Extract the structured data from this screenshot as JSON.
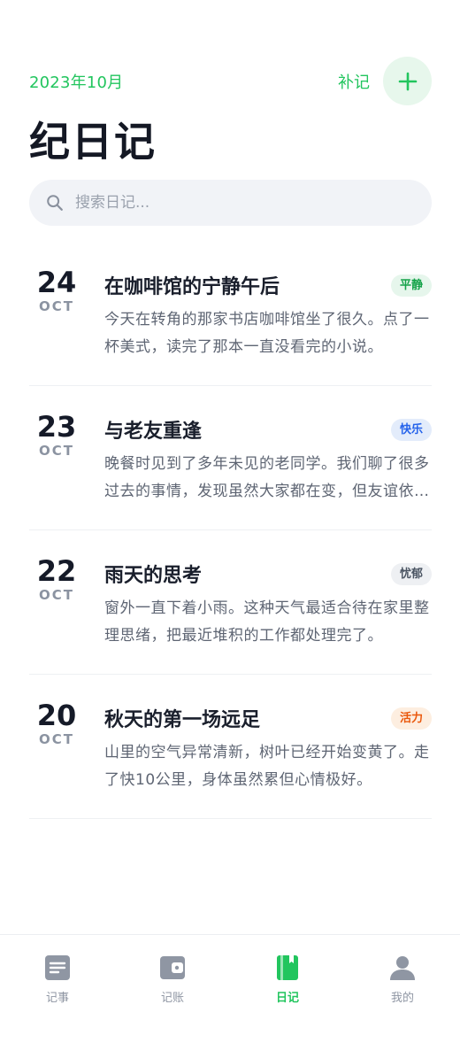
{
  "header": {
    "month": "2023年10月",
    "backfill_label": "补记",
    "title": "纪日记"
  },
  "search": {
    "placeholder": "搜索日记..."
  },
  "colors": {
    "accent": "#22c55e",
    "accent_soft": "#e7f7ec",
    "icon_inactive": "#8f96a3"
  },
  "entries": [
    {
      "day": "24",
      "month": "OCT",
      "title": "在咖啡馆的宁静午后",
      "mood": "平静",
      "mood_color": "#16a34a",
      "mood_bg": "#e6f6ec",
      "excerpt": "今天在转角的那家书店咖啡馆坐了很久。点了一杯美式，读完了那本一直没看完的小说。"
    },
    {
      "day": "23",
      "month": "OCT",
      "title": "与老友重逢",
      "mood": "快乐",
      "mood_color": "#2563eb",
      "mood_bg": "#e3ecfb",
      "excerpt": "晚餐时见到了多年未见的老同学。我们聊了很多过去的事情，发现虽然大家都在变，但友谊依旧。"
    },
    {
      "day": "22",
      "month": "OCT",
      "title": "雨天的思考",
      "mood": "忧郁",
      "mood_color": "#4b5563",
      "mood_bg": "#eef0f3",
      "excerpt": "窗外一直下着小雨。这种天气最适合待在家里整理思绪，把最近堆积的工作都处理完了。"
    },
    {
      "day": "20",
      "month": "OCT",
      "title": "秋天的第一场远足",
      "mood": "活力",
      "mood_color": "#ea580c",
      "mood_bg": "#fdeee0",
      "excerpt": "山里的空气异常清新，树叶已经开始变黄了。走了快10公里，身体虽然累但心情极好。"
    }
  ],
  "tabs": [
    {
      "label": "记事",
      "icon": "note-icon",
      "active": false
    },
    {
      "label": "记账",
      "icon": "wallet-icon",
      "active": false
    },
    {
      "label": "日记",
      "icon": "diary-book-icon",
      "active": true
    },
    {
      "label": "我的",
      "icon": "user-icon",
      "active": false
    }
  ]
}
